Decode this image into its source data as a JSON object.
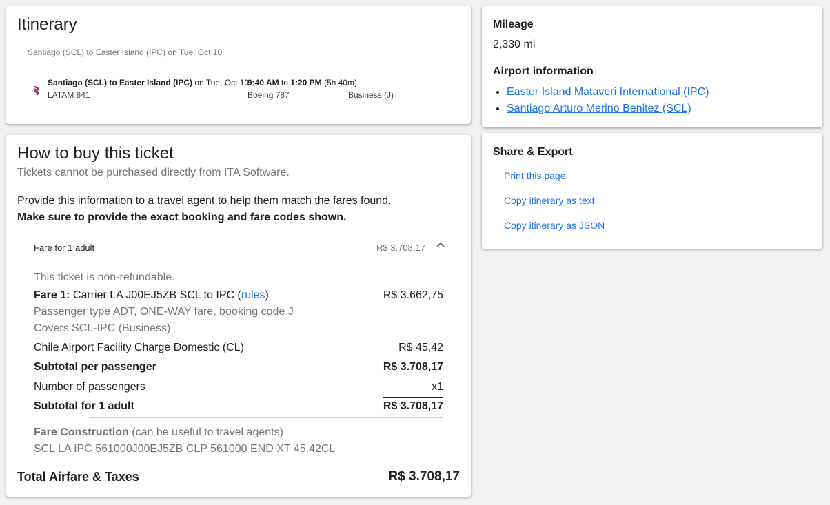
{
  "itinerary": {
    "title": "Itinerary",
    "route_summary": "Santiago (SCL) to Easter Island (IPC) on Tue, Oct 10",
    "segment": {
      "route_bold": "Santiago (SCL) to Easter Island (IPC)",
      "date": " on Tue, Oct 10",
      "depart": "9:40 AM",
      "to": " to ",
      "arrive": "1:20 PM",
      "duration": " (5h 40m)",
      "flight": "LATAM 841",
      "aircraft": "Boeing 787",
      "cabin": "Business (J)"
    }
  },
  "buy": {
    "title": "How to buy this ticket",
    "subtitle": "Tickets cannot be purchased directly from ITA Software.",
    "instructions": "Provide this information to a travel agent to help them match the fares found.",
    "instructions_bold": "Make sure to provide the exact booking and fare codes shown.",
    "fare_header": "Fare for 1 adult",
    "fare_header_price": "R$ 3.708,17",
    "nonrefundable": "This ticket is non-refundable.",
    "fare1_label": "Fare 1:",
    "fare1_desc": " Carrier LA J00EJ5ZB SCL to IPC (",
    "fare1_rules": "rules",
    "fare1_close": ")",
    "fare1_price": "R$ 3.662,75",
    "fare1_line2": "Passenger type ADT, ONE-WAY fare, booking code J",
    "fare1_line3": "Covers SCL-IPC (Business)",
    "tax_label": "Chile Airport Facility Charge Domestic (CL)",
    "tax_price": "R$ 45,42",
    "subtotal_pp_label": "Subtotal per passenger",
    "subtotal_pp_price": "R$ 3.708,17",
    "num_pax_label": "Number of passengers",
    "num_pax_value": "x1",
    "subtotal_adult_label": "Subtotal for 1 adult",
    "subtotal_adult_price": "R$ 3.708,17",
    "fare_construction_label": "Fare Construction",
    "fare_construction_note": " (can be useful to travel agents)",
    "fare_construction": "SCL LA IPC 561000J00EJ5ZB CLP 561000 END XT 45.42CL",
    "total_label": "Total Airfare & Taxes",
    "total_price": "R$ 3.708,17"
  },
  "info": {
    "mileage_title": "Mileage",
    "mileage_value": "2,330 mi",
    "airport_title": "Airport information",
    "airports": [
      "Easter Island Mataveri International (IPC)",
      "Santiago Arturo Merino Benitez (SCL)"
    ]
  },
  "share": {
    "title": "Share & Export",
    "links": [
      "Print this page",
      "Copy itinerary as text",
      "Copy itinerary as JSON"
    ]
  },
  "icons": {
    "airline_logo": "latam-logo-icon",
    "collapse": "chevron-up-icon"
  },
  "colors": {
    "link": "#1a73e8",
    "background": "#f1f1f1"
  }
}
